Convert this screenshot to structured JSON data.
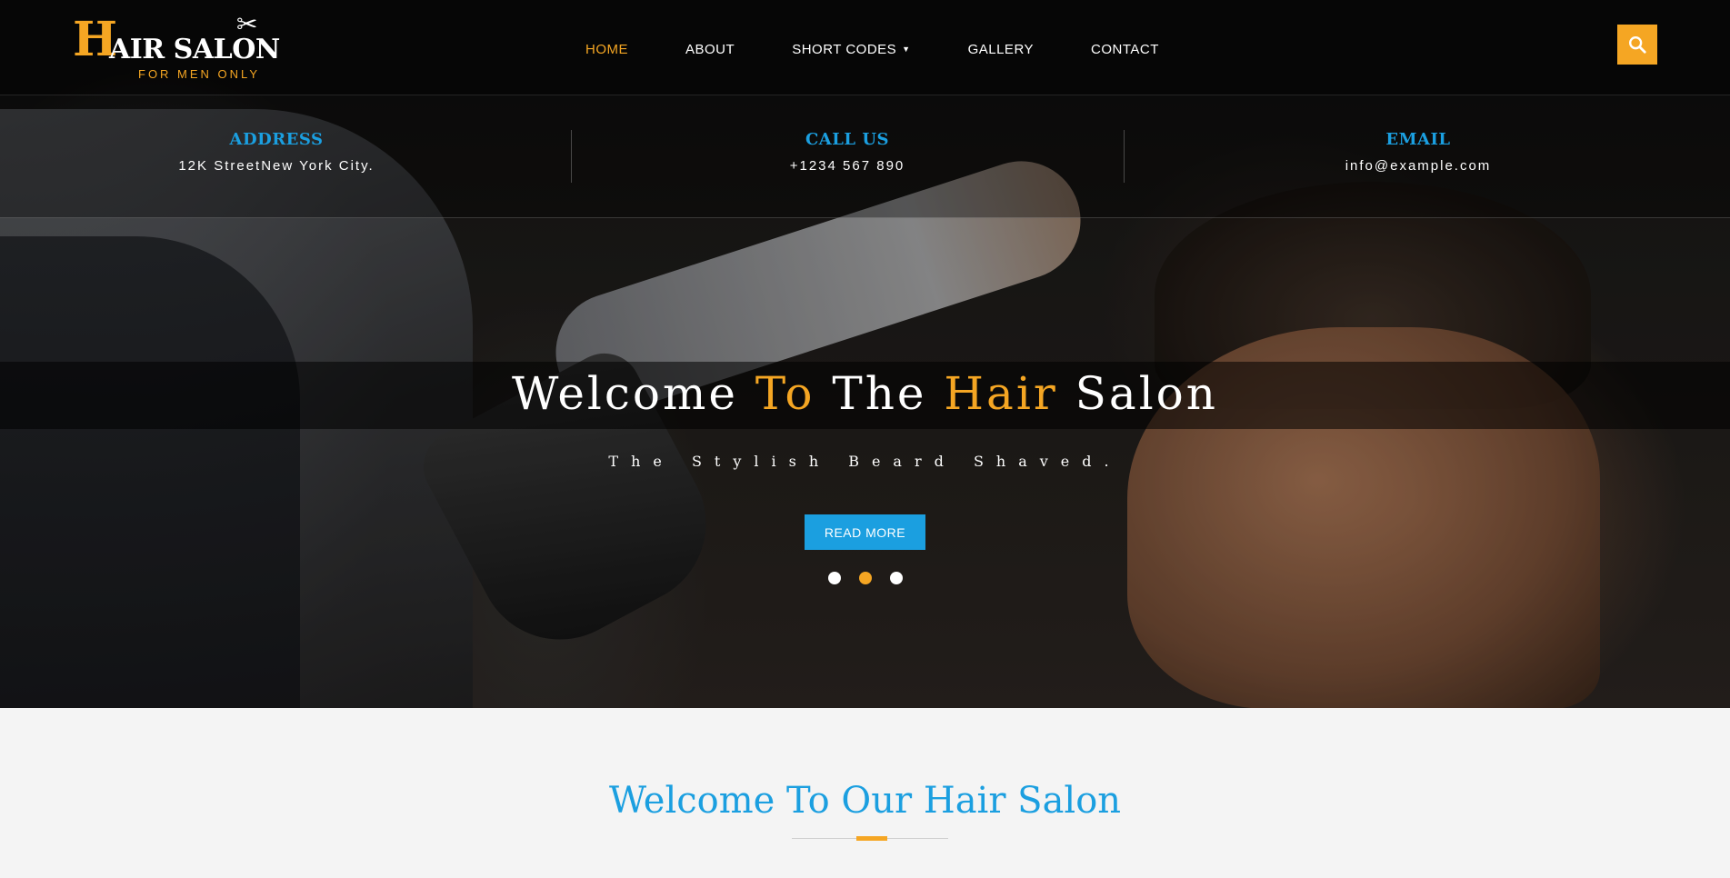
{
  "logo": {
    "initial": "H",
    "rest": "AIR SALON",
    "tagline": "FOR MEN ONLY",
    "icon": "scissors-icon"
  },
  "nav": {
    "items": [
      {
        "label": "HOME",
        "active": true
      },
      {
        "label": "ABOUT",
        "active": false
      },
      {
        "label": "SHORT CODES",
        "active": false,
        "dropdown": true
      },
      {
        "label": "GALLERY",
        "active": false
      },
      {
        "label": "CONTACT",
        "active": false
      }
    ],
    "search_icon": "search-icon"
  },
  "info": {
    "address": {
      "title": "ADDRESS",
      "value": "12K StreetNew York City."
    },
    "call": {
      "title": "CALL US",
      "value": "+1234 567 890"
    },
    "email": {
      "title": "EMAIL",
      "value": "info@example.com"
    }
  },
  "hero": {
    "title_parts": [
      "Welcome ",
      "To",
      " The ",
      "Hair",
      " Salon"
    ],
    "tagline": "The Stylish Beard Shaved.",
    "button_label": "READ MORE",
    "slides": 3,
    "active_slide": 2
  },
  "section": {
    "title": "Welcome To Our Hair Salon"
  },
  "colors": {
    "accent": "#f5a623",
    "blue": "#1b9fe0",
    "dark": "#141414"
  }
}
